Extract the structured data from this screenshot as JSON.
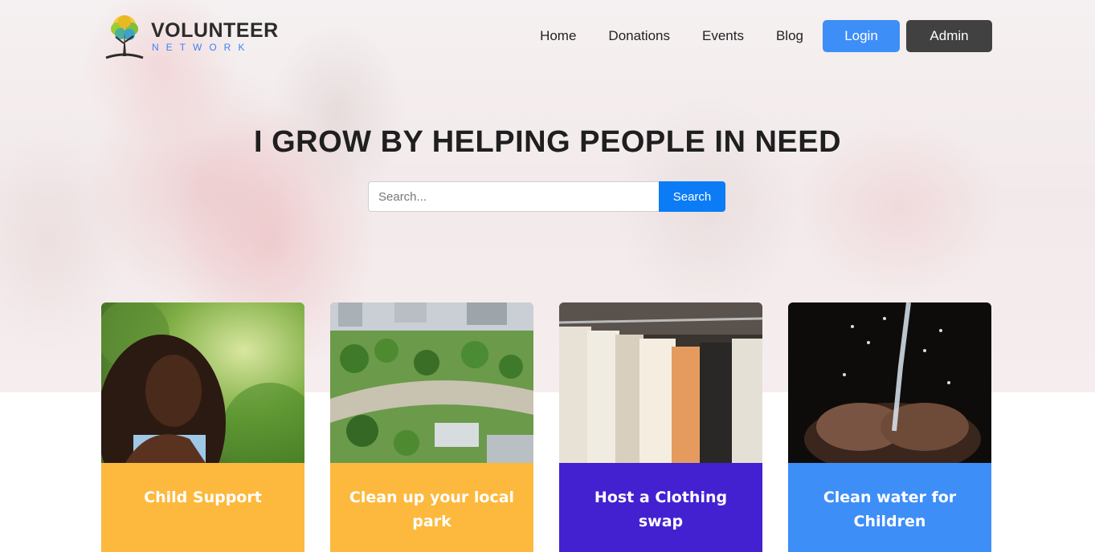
{
  "brand": {
    "title": "VOLUNTEER",
    "subtitle": "NETWORK"
  },
  "nav": {
    "links": [
      "Home",
      "Donations",
      "Events",
      "Blog"
    ],
    "login_label": "Login",
    "admin_label": "Admin"
  },
  "hero": {
    "headline": "I GROW BY HELPING PEOPLE IN NEED",
    "search_placeholder": "Search...",
    "search_button": "Search"
  },
  "cards": [
    {
      "title": "Child Support",
      "color": "#FDB93D",
      "image": "girl-smiling-outdoors"
    },
    {
      "title": "Clean up your local park",
      "color": "#FDB93D",
      "image": "city-park-aerial"
    },
    {
      "title": "Host a Clothing swap",
      "color": "#4321D1",
      "image": "clothes-on-rack"
    },
    {
      "title": "Clean water for Children",
      "color": "#3E8EF7",
      "image": "water-in-hands"
    }
  ],
  "colors": {
    "accent_blue": "#3E8EF7",
    "search_blue": "#0B7CF5",
    "admin_dark": "#414141"
  }
}
